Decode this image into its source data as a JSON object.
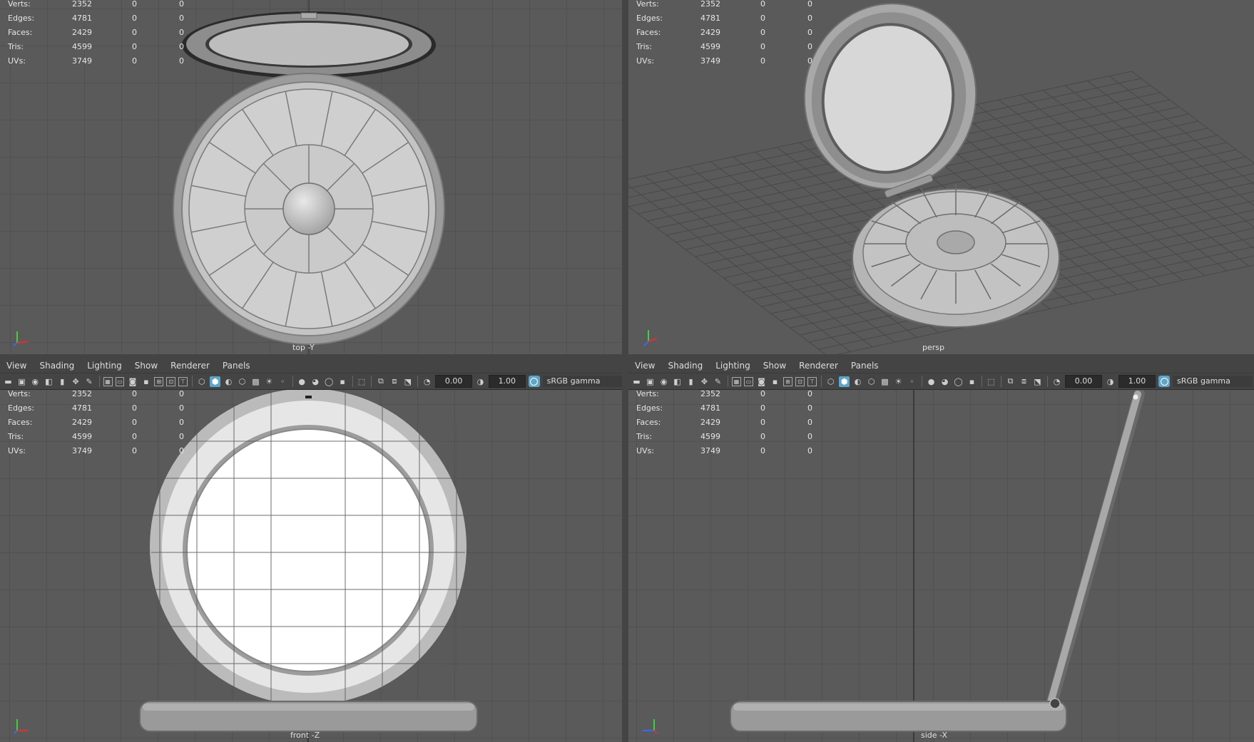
{
  "menu": [
    "View",
    "Shading",
    "Lighting",
    "Show",
    "Renderer",
    "Panels"
  ],
  "toolbar": {
    "exposure": "0.00",
    "gamma": "1.00",
    "color_space": "sRGB gamma"
  },
  "hud": [
    {
      "label": "Verts:",
      "value": "2352",
      "a": "0",
      "b": "0"
    },
    {
      "label": "Edges:",
      "value": "4781",
      "a": "0",
      "b": "0"
    },
    {
      "label": "Faces:",
      "value": "2429",
      "a": "0",
      "b": "0"
    },
    {
      "label": "Tris:",
      "value": "4599",
      "a": "0",
      "b": "0"
    },
    {
      "label": "UVs:",
      "value": "3749",
      "a": "0",
      "b": "0"
    }
  ],
  "viewports": {
    "top": {
      "label": "top -Y"
    },
    "persp": {
      "label": "persp"
    },
    "front": {
      "label": "front -Z"
    },
    "side": {
      "label": "side -X"
    }
  },
  "axis_labels": {
    "x": "x",
    "y": "y",
    "z": "z"
  }
}
